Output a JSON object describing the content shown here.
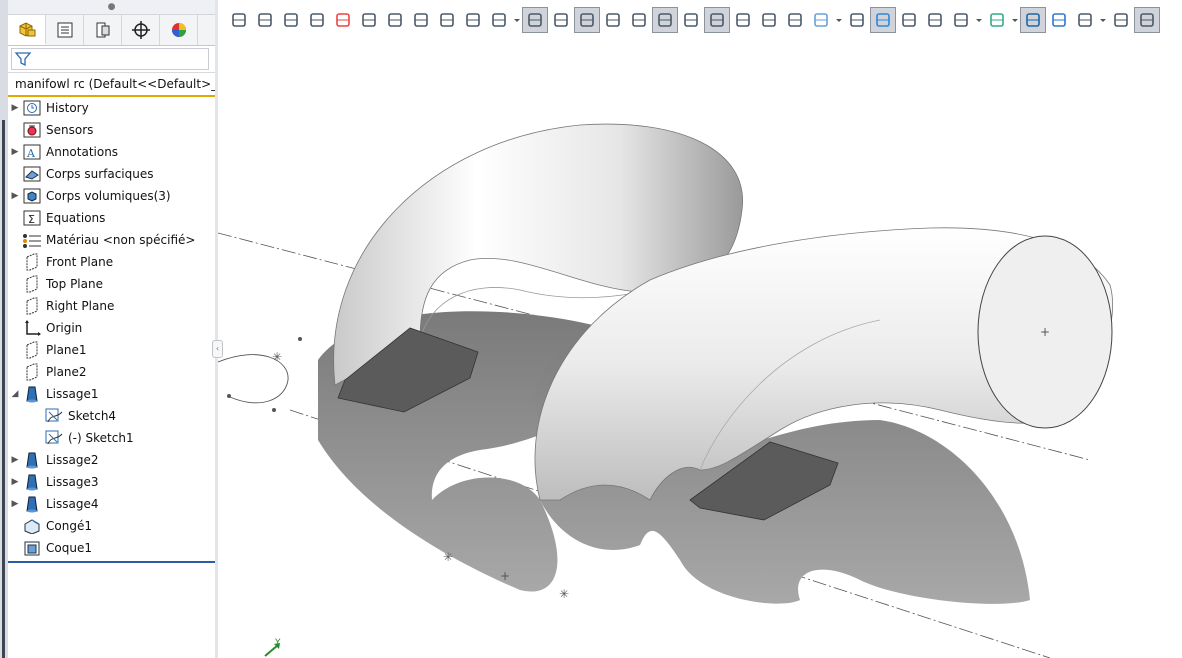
{
  "app": {
    "document_title": "manifowl rc  (Default<<Default>_D"
  },
  "feature_manager": {
    "tabs": [
      {
        "name": "featuremanager-tab",
        "icon": "part-tree-icon"
      },
      {
        "name": "propertymanager-tab",
        "icon": "property-list-icon"
      },
      {
        "name": "configurationmanager-tab",
        "icon": "configuration-icon"
      },
      {
        "name": "dimxpert-tab",
        "icon": "crosshair-icon"
      },
      {
        "name": "display-manager-tab",
        "icon": "appearance-pie-icon"
      }
    ],
    "items": [
      {
        "label": "History",
        "icon": "history-icon",
        "expandable": true
      },
      {
        "label": "Sensors",
        "icon": "sensors-icon",
        "expandable": false
      },
      {
        "label": "Annotations",
        "icon": "annotations-icon",
        "expandable": true
      },
      {
        "label": "Corps surfaciques",
        "icon": "surface-bodies-icon",
        "expandable": false
      },
      {
        "label": "Corps volumiques(3)",
        "icon": "solid-bodies-icon",
        "expandable": true
      },
      {
        "label": "Equations",
        "icon": "equations-icon",
        "expandable": false
      },
      {
        "label": "Matériau <non spécifié>",
        "icon": "material-icon",
        "expandable": false
      },
      {
        "label": "Front Plane",
        "icon": "plane-icon",
        "expandable": false
      },
      {
        "label": "Top Plane",
        "icon": "plane-icon",
        "expandable": false
      },
      {
        "label": "Right Plane",
        "icon": "plane-icon",
        "expandable": false
      },
      {
        "label": "Origin",
        "icon": "origin-icon",
        "expandable": false
      },
      {
        "label": "Plane1",
        "icon": "plane-icon",
        "expandable": false
      },
      {
        "label": "Plane2",
        "icon": "plane-icon",
        "expandable": false
      },
      {
        "label": "Lissage1",
        "icon": "loft-icon",
        "expandable": true,
        "expanded": true
      },
      {
        "label": "Sketch4",
        "icon": "sketch-icon",
        "child": true
      },
      {
        "label": "(-) Sketch1",
        "icon": "sketch-icon",
        "child": true
      },
      {
        "label": "Lissage2",
        "icon": "loft-icon",
        "expandable": true
      },
      {
        "label": "Lissage3",
        "icon": "loft-icon",
        "expandable": true
      },
      {
        "label": "Lissage4",
        "icon": "loft-icon",
        "expandable": true
      },
      {
        "label": "Congé1",
        "icon": "fillet-icon",
        "expandable": false
      },
      {
        "label": "Coque1",
        "icon": "shell-icon",
        "expandable": false
      }
    ]
  },
  "viewport": {
    "triad_axis_label": "Y"
  },
  "colors": {
    "selection_underline": "#e0a800",
    "tree_end_line": "#2a5ca8",
    "axis_green": "#2b8a2b"
  }
}
